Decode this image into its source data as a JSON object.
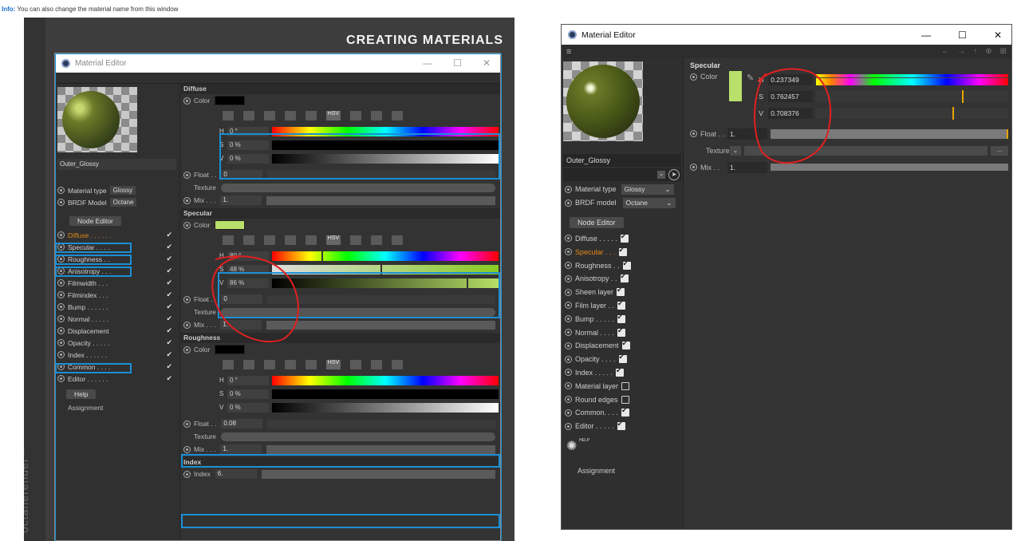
{
  "info": {
    "prefix": "Info:",
    "text": "You can also change the material name from this window"
  },
  "tutorial": {
    "headline": "CREATING MATERIALS",
    "brand": "octanerender™",
    "window_title": "Material Editor",
    "material_name": "Outer_Glossy",
    "material_type_label": "Material type",
    "material_type_value": "Glossy",
    "brdf_label": "BRDF Model",
    "brdf_value": "Octane",
    "node_editor": "Node Editor",
    "channels": [
      "Diffuse . . . . . .",
      "Specular . . . .",
      "Roughness . .",
      "Anisotropy . . .",
      "Filmwidth . . .",
      "Filmindex . . .",
      "Bump . . . . . .",
      "Normal . . . . .",
      "Displacement",
      "Opacity . . . . .",
      "Index . . . . . .",
      "Common . . . .",
      "Editor . . . . . ."
    ],
    "help": "Help",
    "assignment": "Assignment",
    "diffuse": {
      "title": "Diffuse",
      "color": "Color",
      "h": "0 °",
      "s": "0 %",
      "v": "0 %",
      "float_label": "Float . .",
      "float": "0",
      "texture": "Texture",
      "mix_label": "Mix . . .",
      "mix": "1."
    },
    "specular": {
      "title": "Specular",
      "color": "Color",
      "h": "80 °",
      "s": "48 %",
      "v": "86 %",
      "float_label": "Float . .",
      "float": "0",
      "texture": "Texture",
      "mix_label": "Mix . . .",
      "mix": "1."
    },
    "roughness": {
      "title": "Roughness",
      "color": "Color",
      "h": "0 °",
      "s": "0 %",
      "v": "0 %",
      "float_label": "Float . .",
      "float": "0.08",
      "texture": "Texture",
      "mix_label": "Mix . . .",
      "mix": "1."
    },
    "index": {
      "title": "Index",
      "label": "Index",
      "value": "6."
    },
    "hsv_labels": {
      "h": "H",
      "s": "S",
      "v": "V"
    },
    "hsv_icon_text": "HSV"
  },
  "editor": {
    "window_title": "Material Editor",
    "material_name": "Outer_Glossy",
    "material_type_label": "Material type",
    "material_type_value": "Glossy",
    "brdf_label": "BRDF model",
    "brdf_value": "Octane",
    "node_editor": "Node Editor",
    "channels": [
      {
        "label": "Diffuse . . . . .",
        "checked": true,
        "active": false
      },
      {
        "label": "Specular . . .",
        "checked": true,
        "active": true
      },
      {
        "label": "Roughness . .",
        "checked": true,
        "active": false
      },
      {
        "label": "Anisotropy . .",
        "checked": true,
        "active": false
      },
      {
        "label": "Sheen layer",
        "checked": true,
        "active": false
      },
      {
        "label": "Film layer . .",
        "checked": true,
        "active": false
      },
      {
        "label": "Bump . . . . .",
        "checked": true,
        "active": false
      },
      {
        "label": "Normal . . . .",
        "checked": true,
        "active": false
      },
      {
        "label": "Displacement",
        "checked": true,
        "active": false
      },
      {
        "label": "Opacity . . . .",
        "checked": true,
        "active": false
      },
      {
        "label": "Index . . . . .",
        "checked": true,
        "active": false
      },
      {
        "label": "Material layer",
        "checked": false,
        "active": false
      },
      {
        "label": "Round edges",
        "checked": false,
        "active": false
      },
      {
        "label": "Common. . . .",
        "checked": true,
        "active": false
      },
      {
        "label": "Editor . . . . .",
        "checked": true,
        "active": false
      }
    ],
    "help_badge": "HELP",
    "assignment": "Assignment",
    "specular": {
      "title": "Specular",
      "color_label": "Color",
      "h_label": "H",
      "h": "0.237349",
      "s_label": "S",
      "s": "0.762457",
      "v_label": "V",
      "v": "0.708376",
      "float_label": "Float . .",
      "float": "1.",
      "texture_label": "Texture",
      "mix_label": "Mix . .",
      "mix": "1.",
      "more": "..."
    },
    "swatch_color": "#b8e06a",
    "accent": "#e8a400"
  }
}
